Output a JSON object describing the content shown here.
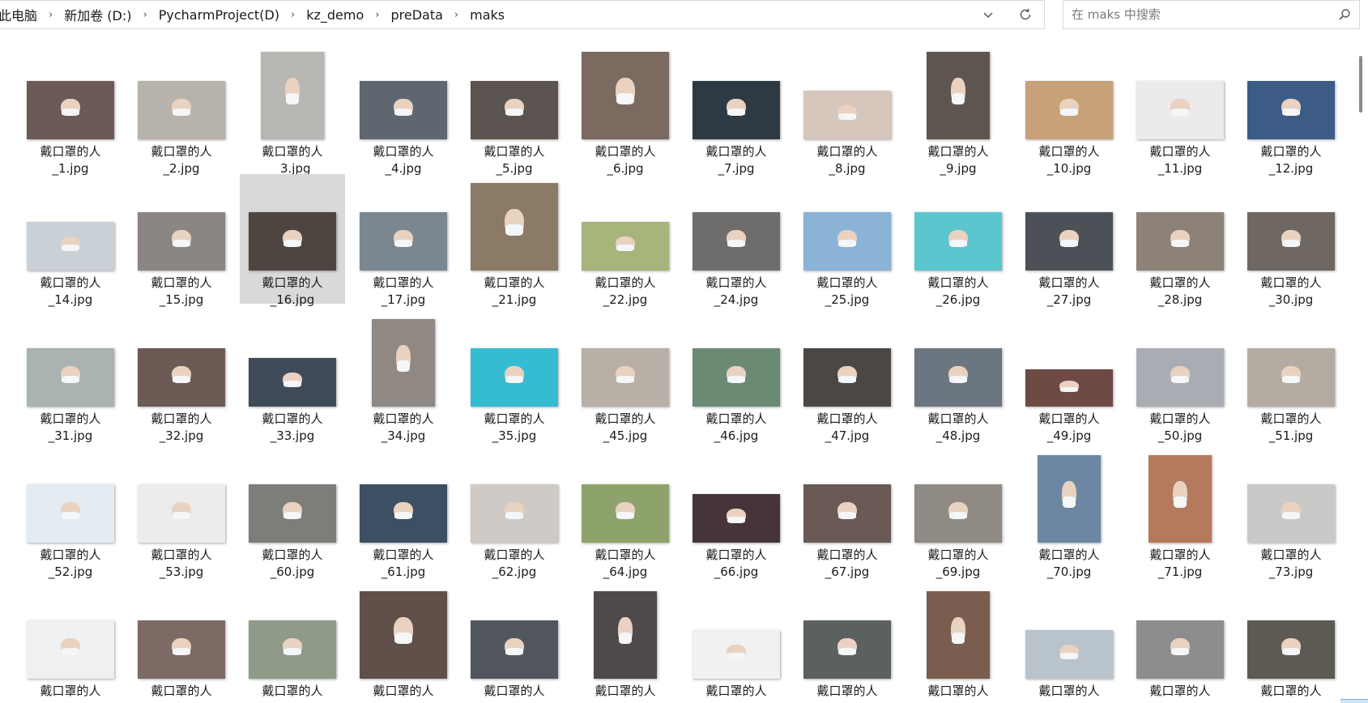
{
  "breadcrumb": [
    "此电脑",
    "新加卷 (D:)",
    "PycharmProject(D)",
    "kz_demo",
    "preData",
    "maks"
  ],
  "search": {
    "placeholder": "在 maks 中搜索"
  },
  "files": [
    {
      "line1": "戴口罩的人",
      "line2": "_1.jpg",
      "thumb": "wide",
      "bg": "#6b5a58"
    },
    {
      "line1": "戴口罩的人",
      "line2": "_2.jpg",
      "thumb": "wide",
      "bg": "#b8b2ad"
    },
    {
      "line1": "戴口罩的人",
      "line2": "_3.jpg",
      "thumb": "tall",
      "bg": "#b9b7b3"
    },
    {
      "line1": "戴口罩的人",
      "line2": "_4.jpg",
      "thumb": "wide",
      "bg": "#5e6670"
    },
    {
      "line1": "戴口罩的人",
      "line2": "_5.jpg",
      "thumb": "wide",
      "bg": "#5b5350"
    },
    {
      "line1": "戴口罩的人",
      "line2": "_6.jpg",
      "thumb": "square",
      "bg": "#7b6a60"
    },
    {
      "line1": "戴口罩的人",
      "line2": "_7.jpg",
      "thumb": "wide",
      "bg": "#2d3a44"
    },
    {
      "line1": "戴口罩的人",
      "line2": "_8.jpg",
      "thumb": "wide-short",
      "bg": "#d6c6bc"
    },
    {
      "line1": "戴口罩的人",
      "line2": "_9.jpg",
      "thumb": "tall",
      "bg": "#5f5550"
    },
    {
      "line1": "戴口罩的人",
      "line2": "_10.jpg",
      "thumb": "wide",
      "bg": "#c7a178"
    },
    {
      "line1": "戴口罩的人",
      "line2": "_11.jpg",
      "thumb": "wide",
      "bg": "#eceaea"
    },
    {
      "line1": "戴口罩的人",
      "line2": "_12.jpg",
      "thumb": "wide",
      "bg": "#3c5c86"
    },
    {
      "line1": "戴口罩的人",
      "line2": "_14.jpg",
      "thumb": "wide-short",
      "bg": "#c9d0d6"
    },
    {
      "line1": "戴口罩的人",
      "line2": "_15.jpg",
      "thumb": "wide",
      "bg": "#8b8684"
    },
    {
      "line1": "戴口罩的人",
      "line2": "_16.jpg",
      "thumb": "wide",
      "bg": "#4e4541",
      "selected": true
    },
    {
      "line1": "戴口罩的人",
      "line2": "_17.jpg",
      "thumb": "wide",
      "bg": "#7a8791"
    },
    {
      "line1": "戴口罩的人",
      "line2": "_21.jpg",
      "thumb": "square",
      "bg": "#8a7a66"
    },
    {
      "line1": "戴口罩的人",
      "line2": "_22.jpg",
      "thumb": "wide-short",
      "bg": "#a7b57c"
    },
    {
      "line1": "戴口罩的人",
      "line2": "_24.jpg",
      "thumb": "wide",
      "bg": "#6f6d6b"
    },
    {
      "line1": "戴口罩的人",
      "line2": "_25.jpg",
      "thumb": "wide",
      "bg": "#8ab3d6"
    },
    {
      "line1": "戴口罩的人",
      "line2": "_26.jpg",
      "thumb": "wide",
      "bg": "#5cc6cf"
    },
    {
      "line1": "戴口罩的人",
      "line2": "_27.jpg",
      "thumb": "wide",
      "bg": "#4b5157"
    },
    {
      "line1": "戴口罩的人",
      "line2": "_28.jpg",
      "thumb": "wide",
      "bg": "#8d8277"
    },
    {
      "line1": "戴口罩的人",
      "line2": "_30.jpg",
      "thumb": "wide",
      "bg": "#6e6762"
    },
    {
      "line1": "戴口罩的人",
      "line2": "_31.jpg",
      "thumb": "wide",
      "bg": "#a9b3b2"
    },
    {
      "line1": "戴口罩的人",
      "line2": "_32.jpg",
      "thumb": "wide",
      "bg": "#6c5a54"
    },
    {
      "line1": "戴口罩的人",
      "line2": "_33.jpg",
      "thumb": "wide-short",
      "bg": "#3f4b58"
    },
    {
      "line1": "戴口罩的人",
      "line2": "_34.jpg",
      "thumb": "tall",
      "bg": "#8f8883"
    },
    {
      "line1": "戴口罩的人",
      "line2": "_35.jpg",
      "thumb": "wide",
      "bg": "#35bcd3"
    },
    {
      "line1": "戴口罩的人",
      "line2": "_45.jpg",
      "thumb": "wide",
      "bg": "#b8afa7"
    },
    {
      "line1": "戴口罩的人",
      "line2": "_46.jpg",
      "thumb": "wide",
      "bg": "#6a8a74"
    },
    {
      "line1": "戴口罩的人",
      "line2": "_47.jpg",
      "thumb": "wide",
      "bg": "#4a4744"
    },
    {
      "line1": "戴口罩的人",
      "line2": "_48.jpg",
      "thumb": "wide",
      "bg": "#6b7680"
    },
    {
      "line1": "戴口罩的人",
      "line2": "_49.jpg",
      "thumb": "wide-shorter",
      "bg": "#6e4a45"
    },
    {
      "line1": "戴口罩的人",
      "line2": "_50.jpg",
      "thumb": "wide",
      "bg": "#a9adb3"
    },
    {
      "line1": "戴口罩的人",
      "line2": "_51.jpg",
      "thumb": "wide",
      "bg": "#b4aca2"
    },
    {
      "line1": "戴口罩的人",
      "line2": "_52.jpg",
      "thumb": "wide",
      "bg": "#e3ecf2"
    },
    {
      "line1": "戴口罩的人",
      "line2": "_53.jpg",
      "thumb": "wide",
      "bg": "#ececec"
    },
    {
      "line1": "戴口罩的人",
      "line2": "_60.jpg",
      "thumb": "wide",
      "bg": "#7d7d7a"
    },
    {
      "line1": "戴口罩的人",
      "line2": "_61.jpg",
      "thumb": "wide",
      "bg": "#3d4f63"
    },
    {
      "line1": "戴口罩的人",
      "line2": "_62.jpg",
      "thumb": "wide",
      "bg": "#cfcac5"
    },
    {
      "line1": "戴口罩的人",
      "line2": "_64.jpg",
      "thumb": "wide",
      "bg": "#8da36b"
    },
    {
      "line1": "戴口罩的人",
      "line2": "_66.jpg",
      "thumb": "wide-short",
      "bg": "#45353a"
    },
    {
      "line1": "戴口罩的人",
      "line2": "_67.jpg",
      "thumb": "wide",
      "bg": "#6a5a55"
    },
    {
      "line1": "戴口罩的人",
      "line2": "_69.jpg",
      "thumb": "wide",
      "bg": "#8f8a84"
    },
    {
      "line1": "戴口罩的人",
      "line2": "_70.jpg",
      "thumb": "tall",
      "bg": "#6d87a3"
    },
    {
      "line1": "戴口罩的人",
      "line2": "_71.jpg",
      "thumb": "tall",
      "bg": "#b57a5e"
    },
    {
      "line1": "戴口罩的人",
      "line2": "_73.jpg",
      "thumb": "wide",
      "bg": "#c9cac8"
    },
    {
      "line1": "戴口罩的人",
      "line2": "",
      "thumb": "wide",
      "bg": "#eef0f1"
    },
    {
      "line1": "戴口罩的人",
      "line2": "",
      "thumb": "wide",
      "bg": "#7d6a64"
    },
    {
      "line1": "戴口罩的人",
      "line2": "",
      "thumb": "wide",
      "bg": "#8f9a88"
    },
    {
      "line1": "戴口罩的人",
      "line2": "",
      "thumb": "square",
      "bg": "#5f5049"
    },
    {
      "line1": "戴口罩的人",
      "line2": "",
      "thumb": "wide",
      "bg": "#52565e"
    },
    {
      "line1": "戴口罩的人",
      "line2": "",
      "thumb": "tall",
      "bg": "#4d4a49"
    },
    {
      "line1": "戴口罩的人",
      "line2": "",
      "thumb": "wide-short",
      "bg": "#f1f1f1"
    },
    {
      "line1": "戴口罩的人",
      "line2": "",
      "thumb": "wide",
      "bg": "#5b615e"
    },
    {
      "line1": "戴口罩的人",
      "line2": "",
      "thumb": "tall",
      "bg": "#7a5d4e"
    },
    {
      "line1": "戴口罩的人",
      "line2": "",
      "thumb": "wide-short",
      "bg": "#b9c3cc"
    },
    {
      "line1": "戴口罩的人",
      "line2": "",
      "thumb": "wide",
      "bg": "#8d8c8f"
    },
    {
      "line1": "戴口罩的人",
      "line2": "",
      "thumb": "wide",
      "bg": "#5d5a53"
    }
  ]
}
